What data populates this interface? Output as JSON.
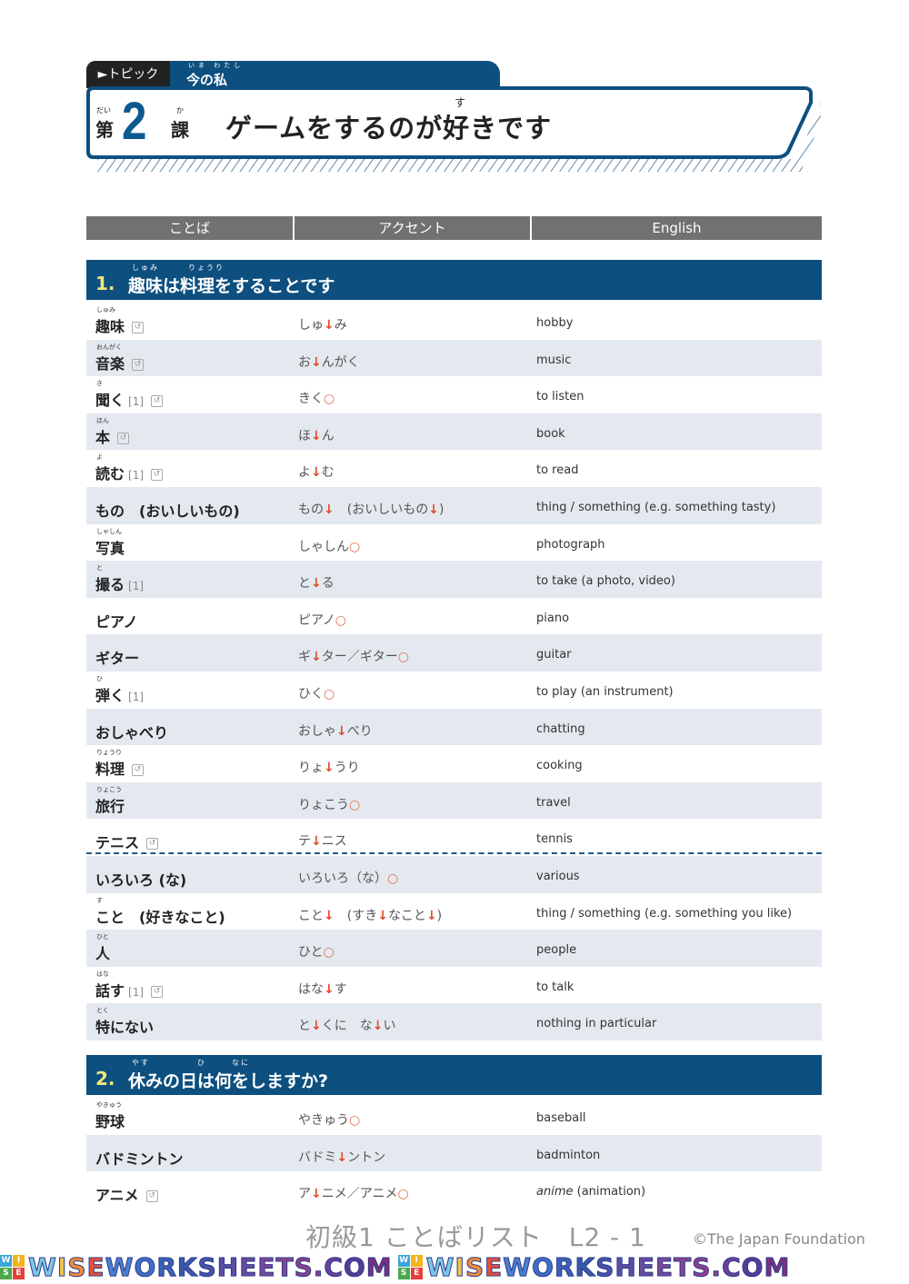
{
  "header": {
    "topic_label": "►トピック",
    "topic_name": "今の私",
    "topic_ruby": "いま わたし",
    "lesson_dai_ruby": "だい",
    "lesson_dai": "第",
    "lesson_number": "2",
    "lesson_ka_ruby": "か",
    "lesson_ka": "課",
    "lesson_title": "ゲームをするのが好きです",
    "lesson_title_ruby": "す"
  },
  "columns": {
    "word": "ことば",
    "accent": "アクセント",
    "english": "English"
  },
  "colors": {
    "brand_blue": "#0d4f7f",
    "header_gray": "#6f7270",
    "row_alt": "#e4e9f0",
    "accent_red": "#e04a2a",
    "section_number": "#f3e67a"
  },
  "sections": [
    {
      "number": "1.",
      "title": "趣味は料理をすることです",
      "ruby": [
        "しゅみ",
        "りょうり"
      ],
      "rows": [
        {
          "ruby": "しゅみ",
          "word": "趣味",
          "group": "",
          "redo": true,
          "accent": [
            [
              "しゅ",
              ""
            ],
            [
              "↓",
              "down"
            ],
            [
              "み",
              ""
            ]
          ],
          "english": "hobby"
        },
        {
          "ruby": "おんがく",
          "word": "音楽",
          "group": "",
          "redo": true,
          "accent": [
            [
              "お",
              ""
            ],
            [
              "↓",
              "down"
            ],
            [
              "んがく",
              ""
            ]
          ],
          "english": "music"
        },
        {
          "ruby": "き",
          "word": "聞く",
          "group": "[1]",
          "redo": true,
          "accent": [
            [
              "きく",
              ""
            ],
            [
              "○",
              "flat"
            ]
          ],
          "english": "to listen"
        },
        {
          "ruby": "ほん",
          "word": "本",
          "group": "",
          "redo": true,
          "accent": [
            [
              "ほ",
              ""
            ],
            [
              "↓",
              "down"
            ],
            [
              "ん",
              ""
            ]
          ],
          "english": "book"
        },
        {
          "ruby": "よ",
          "word": "読む",
          "group": "[1]",
          "redo": true,
          "accent": [
            [
              "よ",
              ""
            ],
            [
              "↓",
              "down"
            ],
            [
              "む",
              ""
            ]
          ],
          "english": "to read"
        },
        {
          "ruby": "",
          "word": "もの　(おいしいもの)",
          "group": "",
          "redo": false,
          "accent": [
            [
              "もの",
              ""
            ],
            [
              "↓",
              "down"
            ],
            [
              "　(おいしいもの",
              ""
            ],
            [
              "↓",
              "down"
            ],
            [
              ")",
              ""
            ]
          ],
          "english": "thing / something (e.g. something tasty)"
        },
        {
          "ruby": "しゃしん",
          "word": "写真",
          "group": "",
          "redo": false,
          "accent": [
            [
              "しゃしん",
              ""
            ],
            [
              "○",
              "flat"
            ]
          ],
          "english": "photograph"
        },
        {
          "ruby": "と",
          "word": "撮る",
          "group": "[1]",
          "redo": false,
          "accent": [
            [
              "と",
              ""
            ],
            [
              "↓",
              "down"
            ],
            [
              "る",
              ""
            ]
          ],
          "english": "to take (a photo, video)"
        },
        {
          "ruby": "",
          "word": "ピアノ",
          "group": "",
          "redo": false,
          "accent": [
            [
              "ピアノ",
              ""
            ],
            [
              "○",
              "flat"
            ]
          ],
          "english": "piano"
        },
        {
          "ruby": "",
          "word": "ギター",
          "group": "",
          "redo": false,
          "accent": [
            [
              "ギ",
              ""
            ],
            [
              "↓",
              "down"
            ],
            [
              "ター／ギター",
              ""
            ],
            [
              "○",
              "flat"
            ]
          ],
          "english": "guitar"
        },
        {
          "ruby": "ひ",
          "word": "弾く",
          "group": "[1]",
          "redo": false,
          "accent": [
            [
              "ひく",
              ""
            ],
            [
              "○",
              "flat"
            ]
          ],
          "english": "to play (an instrument)"
        },
        {
          "ruby": "",
          "word": "おしゃべり",
          "group": "",
          "redo": false,
          "accent": [
            [
              "おしゃ",
              ""
            ],
            [
              "↓",
              "down"
            ],
            [
              "べり",
              ""
            ]
          ],
          "english": "chatting"
        },
        {
          "ruby": "りょうり",
          "word": "料理",
          "group": "",
          "redo": true,
          "accent": [
            [
              "りょ",
              ""
            ],
            [
              "↓",
              "down"
            ],
            [
              "うり",
              ""
            ]
          ],
          "english": "cooking"
        },
        {
          "ruby": "りょこう",
          "word": "旅行",
          "group": "",
          "redo": false,
          "accent": [
            [
              "りょこう",
              ""
            ],
            [
              "○",
              "flat"
            ]
          ],
          "english": "travel"
        },
        {
          "ruby": "",
          "word": "テニス",
          "group": "",
          "redo": true,
          "accent": [
            [
              "テ",
              ""
            ],
            [
              "↓",
              "down"
            ],
            [
              "ニス",
              ""
            ]
          ],
          "english": "tennis"
        },
        {
          "ruby": "",
          "word": "いろいろ (な)",
          "group": "",
          "redo": false,
          "accent": [
            [
              "いろいろ（な）",
              ""
            ],
            [
              "○",
              "flat"
            ]
          ],
          "english": "various"
        },
        {
          "ruby": "す",
          "word": "こと　(好きなこと)",
          "group": "",
          "redo": false,
          "accent": [
            [
              "こと",
              ""
            ],
            [
              "↓",
              "down"
            ],
            [
              "　(すき",
              ""
            ],
            [
              "↓",
              "down"
            ],
            [
              "なこと",
              ""
            ],
            [
              "↓",
              "down"
            ],
            [
              ")",
              ""
            ]
          ],
          "english": "thing / something (e.g. something you like)"
        },
        {
          "ruby": "ひと",
          "word": "人",
          "group": "",
          "redo": false,
          "accent": [
            [
              "ひと",
              ""
            ],
            [
              "○",
              "flat"
            ]
          ],
          "english": "people"
        },
        {
          "ruby": "はな",
          "word": "話す",
          "group": "[1]",
          "redo": true,
          "accent": [
            [
              "はな",
              ""
            ],
            [
              "↓",
              "down"
            ],
            [
              "す",
              ""
            ]
          ],
          "english": "to talk"
        },
        {
          "ruby": "とく",
          "word": "特にない",
          "group": "",
          "redo": false,
          "accent": [
            [
              "と",
              ""
            ],
            [
              "↓",
              "down"
            ],
            [
              "くに　な",
              ""
            ],
            [
              "↓",
              "down"
            ],
            [
              "い",
              ""
            ]
          ],
          "english": "nothing in particular"
        }
      ]
    },
    {
      "number": "2.",
      "title": "休みの日は何をしますか?",
      "ruby": [
        "やす",
        "ひ",
        "なに"
      ],
      "rows": [
        {
          "ruby": "やきゅう",
          "word": "野球",
          "group": "",
          "redo": false,
          "accent": [
            [
              "やきゅう",
              ""
            ],
            [
              "○",
              "flat"
            ]
          ],
          "english": "baseball"
        },
        {
          "ruby": "",
          "word": "バドミントン",
          "group": "",
          "redo": false,
          "accent": [
            [
              "バドミ",
              ""
            ],
            [
              "↓",
              "down"
            ],
            [
              "ントン",
              ""
            ]
          ],
          "english": "badminton"
        },
        {
          "ruby": "",
          "word": "アニメ",
          "group": "",
          "redo": true,
          "accent": [
            [
              "ア",
              ""
            ],
            [
              "↓",
              "down"
            ],
            [
              "ニメ／アニメ",
              ""
            ],
            [
              "○",
              "flat"
            ]
          ],
          "english_italic": "anime",
          "english": " (animation)"
        }
      ]
    }
  ],
  "icons": {
    "redo": "↺"
  },
  "footer": {
    "title": "初級1 ことばリスト　L2 - 1",
    "copyright": "©The Japan Foundation"
  },
  "watermark": {
    "text": "WISEWORKSHEETS.COM",
    "logo_letters": [
      "W",
      "I",
      "S",
      "E"
    ]
  }
}
